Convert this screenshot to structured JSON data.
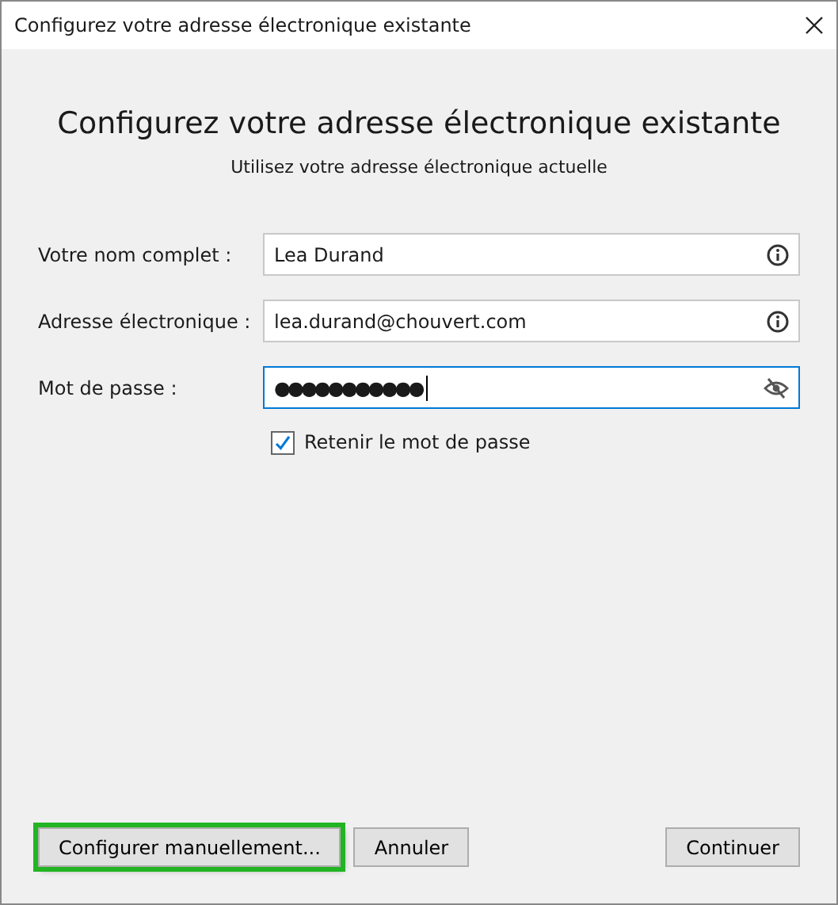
{
  "window": {
    "title": "Configurez votre adresse électronique existante"
  },
  "heading": "Configurez votre adresse électronique existante",
  "subheading": "Utilisez votre adresse électronique actuelle",
  "fields": [
    {
      "label": "Votre nom complet :",
      "value": "Lea Durand",
      "kind": "info",
      "focused": false
    },
    {
      "label": "Adresse électronique :",
      "value": "lea.durand@chouvert.com",
      "kind": "info",
      "focused": false
    },
    {
      "label": "Mot de passe :",
      "value": "●●●●●●●●●●●",
      "kind": "password",
      "focused": true
    }
  ],
  "remember": {
    "label": "Retenir le mot de passe",
    "checked": true
  },
  "buttons": {
    "left": [
      {
        "label": "Configurer manuellement...",
        "highlighted": true
      },
      {
        "label": "Annuler",
        "highlighted": false
      }
    ],
    "right": [
      {
        "label": "Continuer",
        "highlighted": false
      }
    ]
  }
}
